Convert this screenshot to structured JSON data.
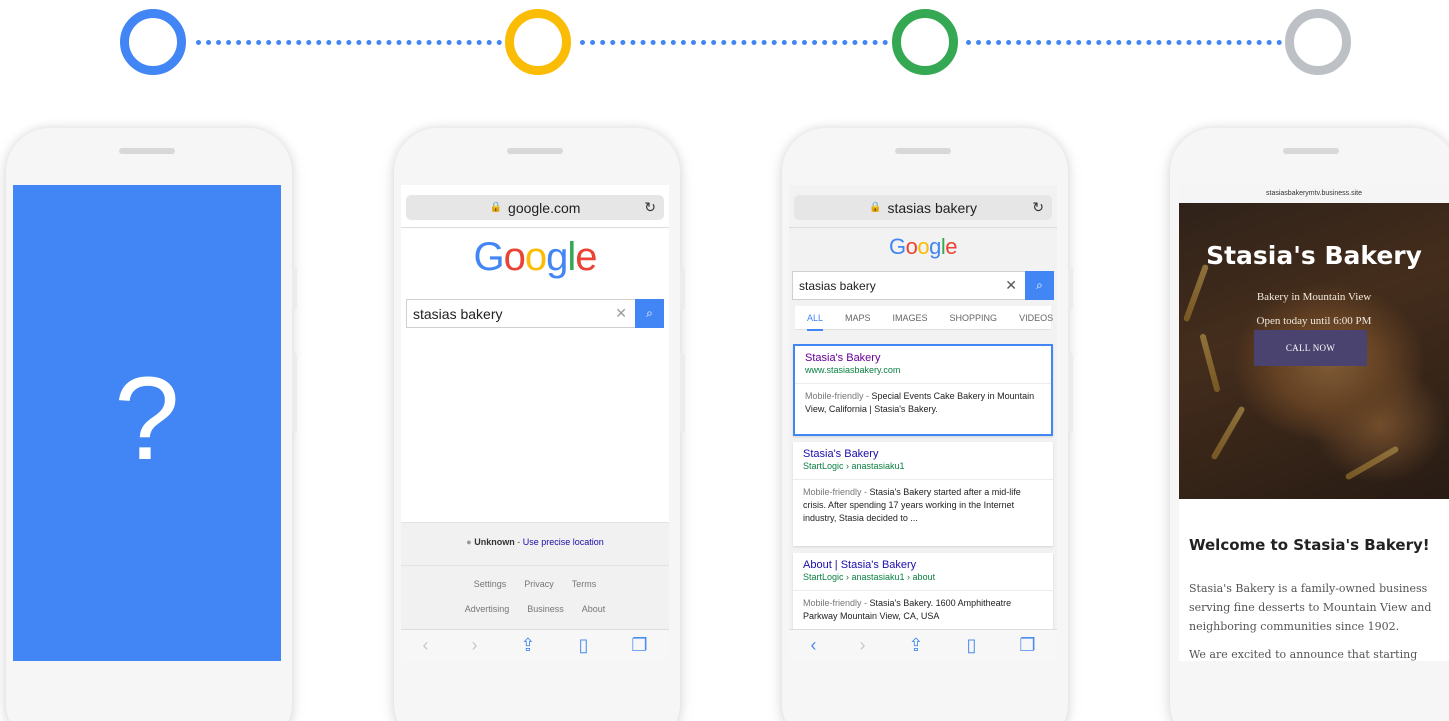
{
  "colors": {
    "blue": "#4285F4",
    "yellow": "#FBBC05",
    "green": "#34A853",
    "gray": "#BDC1C6"
  },
  "timeline": [
    "blue-ring",
    "yellow-ring",
    "green-ring",
    "gray-ring"
  ],
  "phone1": {
    "question": "?"
  },
  "phone2": {
    "url": "google.com",
    "logo": [
      "G",
      "o",
      "o",
      "g",
      "l",
      "e"
    ],
    "query": "stasias bakery",
    "clear": "✕",
    "location_label": "Unknown",
    "location_dash": " - ",
    "location_link": "Use precise location",
    "footer_row1": [
      "Settings",
      "Privacy",
      "Terms"
    ],
    "footer_row2": [
      "Advertising",
      "Business",
      "About"
    ]
  },
  "phone3": {
    "url": "stasias bakery",
    "logo": [
      "G",
      "o",
      "o",
      "g",
      "l",
      "e"
    ],
    "query": "stasias bakery",
    "tabs": [
      "ALL",
      "MAPS",
      "IMAGES",
      "SHOPPING",
      "VIDEOS"
    ],
    "results": [
      {
        "title": "Stasia's Bakery",
        "url": "www.stasiasbakery.com",
        "mf": "Mobile-friendly - ",
        "desc": "Special Events Cake Bakery in Mountain View, California | Stasia's Bakery."
      },
      {
        "title": "Stasia's Bakery",
        "url": "StartLogic › anastasiaku1",
        "mf": "Mobile-friendly - ",
        "desc": "Stasia's Bakery started after a mid-life crisis. After spending 17 years working in the Internet industry, Stasia decided to ..."
      },
      {
        "title": "About | Stasia's Bakery",
        "url": "StartLogic › anastasiaku1 › about",
        "mf": "Mobile-friendly - ",
        "desc": "Stasia's Bakery. 1600 Amphitheatre Parkway Mountain View, CA, USA"
      }
    ]
  },
  "phone4": {
    "url": "stasiasbakerymtv.business.site",
    "title": "Stasia's Bakery",
    "subtitle": "Bakery in Mountain View",
    "hours": "Open today until 6:00 PM",
    "call": "CALL NOW",
    "welcome": "Welcome to Stasia's Bakery!",
    "about": "Stasia's Bakery is a family-owned business serving fine desserts to Mountain View and neighboring communities since 1902.",
    "about2": "We are excited to announce that starting"
  }
}
